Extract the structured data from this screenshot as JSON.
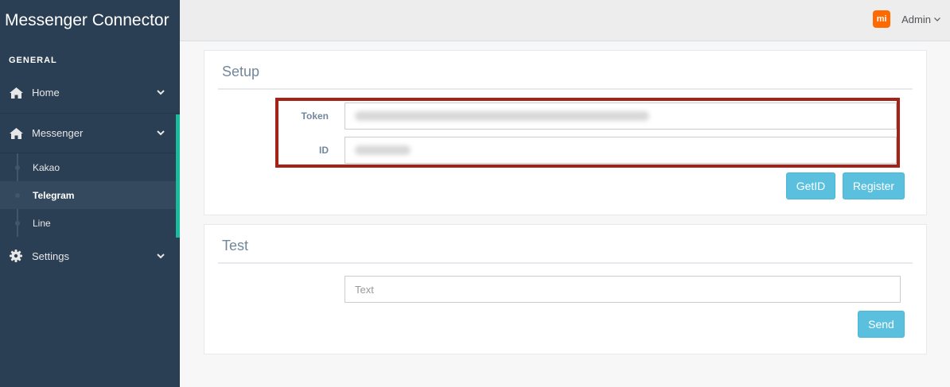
{
  "app": {
    "title": "Messenger Connector"
  },
  "sidebar": {
    "section": "GENERAL",
    "items": [
      {
        "label": "Home",
        "icon": "home-icon"
      },
      {
        "label": "Messenger",
        "icon": "home-icon"
      },
      {
        "label": "Settings",
        "icon": "gear-icon"
      }
    ],
    "messenger_children": [
      {
        "label": "Kakao"
      },
      {
        "label": "Telegram"
      },
      {
        "label": "Line"
      }
    ],
    "accent_color": "#1abb9c"
  },
  "topbar": {
    "user": "Admin",
    "logo_text": "mi"
  },
  "setup": {
    "title": "Setup",
    "token_label": "Token",
    "id_label": "ID",
    "getid_label": "GetID",
    "register_label": "Register"
  },
  "test": {
    "title": "Test",
    "text_placeholder": "Text",
    "send_label": "Send"
  }
}
